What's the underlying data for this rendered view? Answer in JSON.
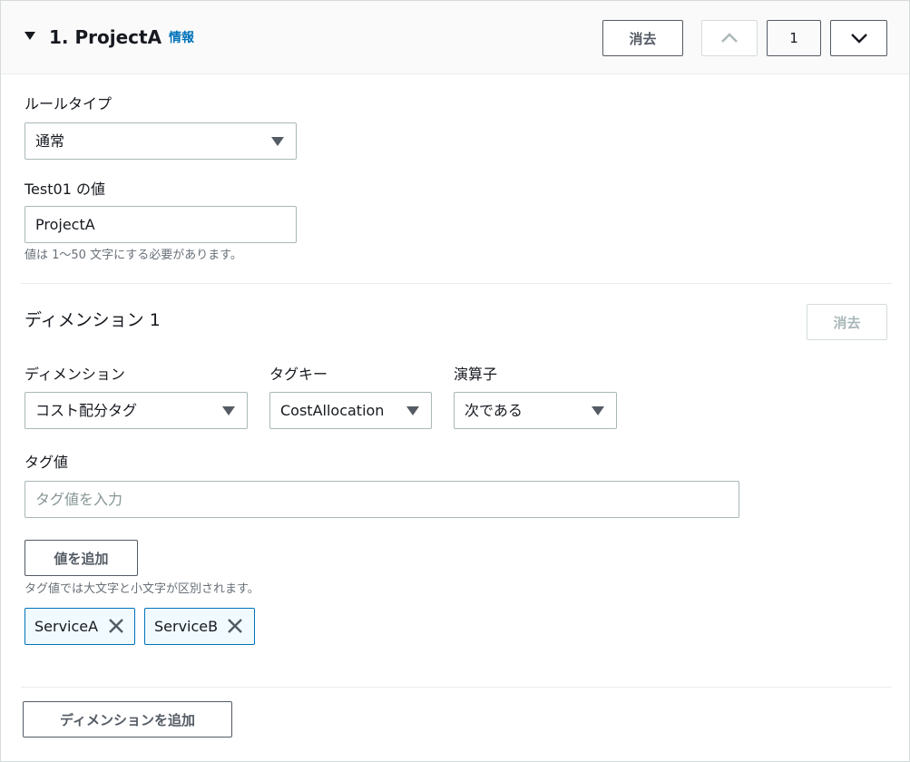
{
  "header": {
    "title": "1. ProjectA",
    "info_link": "情報",
    "delete_label": "消去",
    "page_number": "1"
  },
  "rule_type": {
    "label": "ルールタイプ",
    "value": "通常"
  },
  "value_field": {
    "label": "Test01 の値",
    "value": "ProjectA",
    "hint": "値は 1〜50 文字にする必要があります。"
  },
  "dimension": {
    "title": "ディメンション 1",
    "delete_label": "消去",
    "dimension_label": "ディメンション",
    "dimension_value": "コスト配分タグ",
    "tag_key_label": "タグキー",
    "tag_key_value": "CostAllocation",
    "operator_label": "演算子",
    "operator_value": "次である",
    "tag_value_label": "タグ値",
    "tag_value_placeholder": "タグ値を入力",
    "add_value_label": "値を追加",
    "case_hint": "タグ値では大文字と小文字が区別されます。",
    "tokens": [
      "ServiceA",
      "ServiceB"
    ]
  },
  "footer": {
    "add_dimension_label": "ディメンションを追加"
  },
  "colors": {
    "accent": "#0073bb",
    "token_bg": "#f1faff",
    "border": "#aab7b8"
  }
}
